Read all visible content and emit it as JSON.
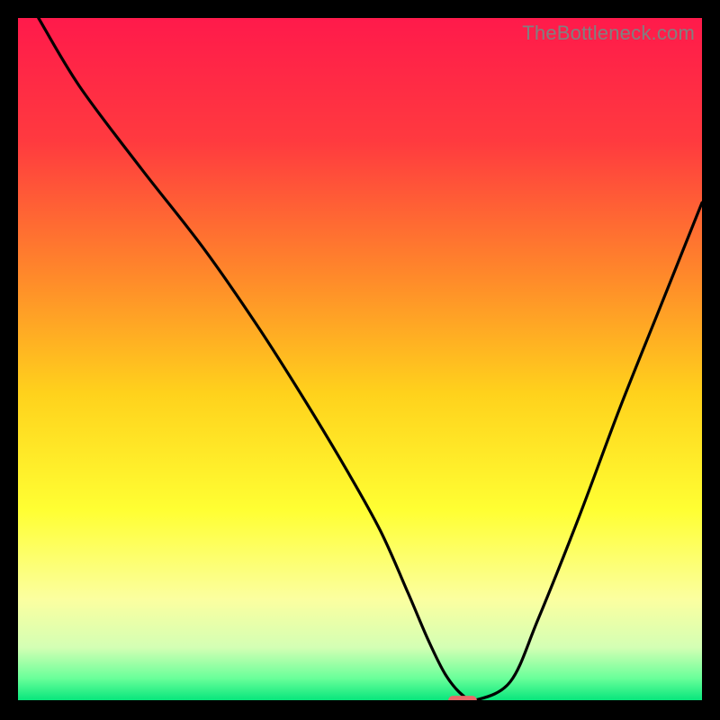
{
  "watermark": "TheBottleneck.com",
  "chart_data": {
    "type": "line",
    "title": "",
    "xlabel": "",
    "ylabel": "",
    "xlim": [
      0,
      100
    ],
    "ylim": [
      0,
      100
    ],
    "grid": false,
    "legend": false,
    "background_gradient": {
      "stops": [
        {
          "offset": 0.0,
          "color": "#ff1a4b"
        },
        {
          "offset": 0.18,
          "color": "#ff3a3f"
        },
        {
          "offset": 0.38,
          "color": "#ff8a2a"
        },
        {
          "offset": 0.55,
          "color": "#ffd21c"
        },
        {
          "offset": 0.72,
          "color": "#ffff33"
        },
        {
          "offset": 0.85,
          "color": "#fbffa0"
        },
        {
          "offset": 0.92,
          "color": "#d4ffb4"
        },
        {
          "offset": 0.965,
          "color": "#6aff9a"
        },
        {
          "offset": 1.0,
          "color": "#00e47a"
        }
      ]
    },
    "series": [
      {
        "name": "bottleneck-curve",
        "color": "#000000",
        "x": [
          3,
          9,
          18,
          27,
          35,
          42,
          48,
          53,
          57,
          60,
          62.5,
          65,
          67,
          72,
          76,
          82,
          88,
          94,
          100
        ],
        "y": [
          100,
          90,
          78,
          66.5,
          55,
          44,
          34,
          25,
          16,
          9,
          4,
          1,
          0.3,
          3,
          12,
          27,
          43,
          58,
          73
        ]
      }
    ],
    "marker": {
      "name": "optimal-point",
      "shape": "pill",
      "color": "#e86a6a",
      "x": 65,
      "y": 0.2,
      "width_pct": 4.2,
      "height_pct": 1.4
    }
  }
}
